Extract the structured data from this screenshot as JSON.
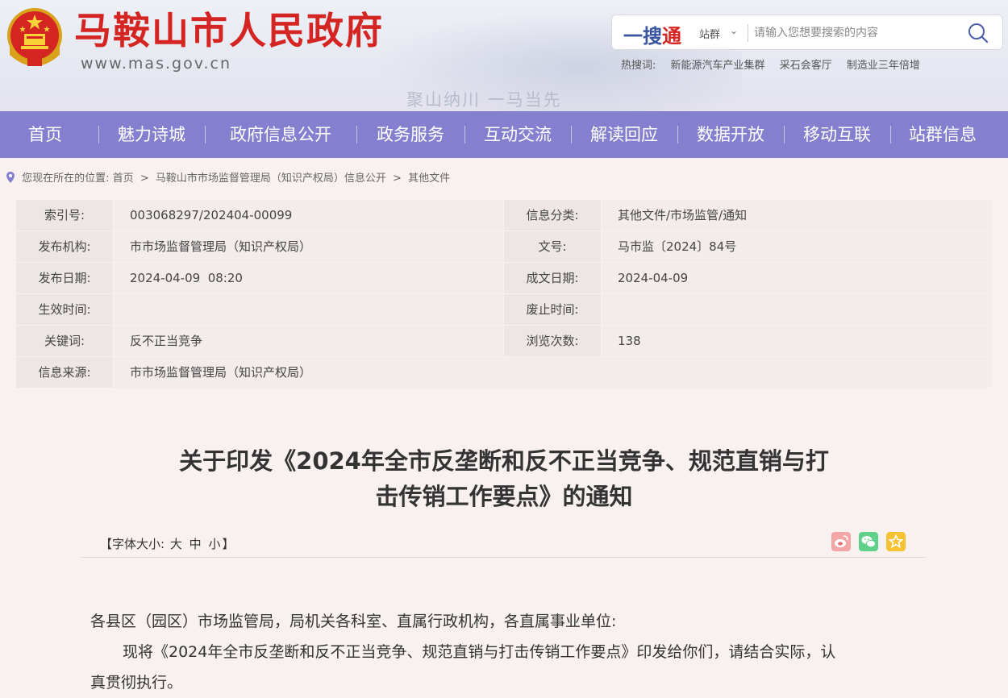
{
  "header": {
    "site_title": "马鞍山市人民政府",
    "site_url": "www.mas.gov.cn",
    "slogan": "聚山纳川  一马当先",
    "emblem_icon": "national-emblem-icon",
    "brand_red": "#d52522"
  },
  "search": {
    "logo_a": "一搜",
    "logo_b": "通",
    "scope": "站群",
    "placeholder": "请输入您想要搜索的内容",
    "hot_label": "热搜词:",
    "hot_words": [
      "新能源汽车产业集群",
      "采石会客厅",
      "制造业三年倍增"
    ]
  },
  "nav": {
    "background": "#8480cf",
    "items": [
      "首页",
      "魅力诗城",
      "政府信息公开",
      "政务服务",
      "互动交流",
      "解读回应",
      "数据开放",
      "移动互联",
      "站群信息"
    ]
  },
  "breadcrumb": {
    "prefix": "您现在所在的位置:",
    "items": [
      "首页",
      "马鞍山市市场监督管理局（知识产权局）信息公开",
      "其他文件"
    ],
    "separator": ">"
  },
  "info": {
    "rows": [
      {
        "l1": "索引号:",
        "v1": "003068297/202404-00099",
        "l2": "信息分类:",
        "v2": "其他文件/市场监管/通知"
      },
      {
        "l1": "发布机构:",
        "v1": "市市场监督管理局（知识产权局）",
        "l2": "文号:",
        "v2": "马市监〔2024〕84号"
      },
      {
        "l1": "发布日期:",
        "v1": "2024-04-09  08:20",
        "l2": "成文日期:",
        "v2": "2024-04-09"
      },
      {
        "l1": "生效时间:",
        "v1": "",
        "l2": "废止时间:",
        "v2": ""
      },
      {
        "l1": "关键词:",
        "v1": "反不正当竞争",
        "l2": "浏览次数:",
        "v2": "138"
      },
      {
        "l1": "信息来源:",
        "v1": "市市场监督管理局（知识产权局）"
      }
    ]
  },
  "article": {
    "title_line1": "关于印发《2024年全市反垄断和反不正当竞争、规范直销与打",
    "title_line2": "击传销工作要点》的通知",
    "font_size_label": "【字体大小:",
    "font_large": "大",
    "font_medium": "中",
    "font_small": "小",
    "font_size_end": "】",
    "share": {
      "weibo": "weibo-icon",
      "wechat": "wechat-icon",
      "favorite": "favorite-icon"
    },
    "paragraph1": "各县区（园区）市场监管局，局机关各科室、直属行政机构，各直属事业单位:",
    "paragraph2_line1": "现将《2024年全市反垄断和反不正当竞争、规范直销与打击传销工作要点》印发给你们，请结合实际，认",
    "paragraph2_line2": "真贯彻执行。"
  }
}
